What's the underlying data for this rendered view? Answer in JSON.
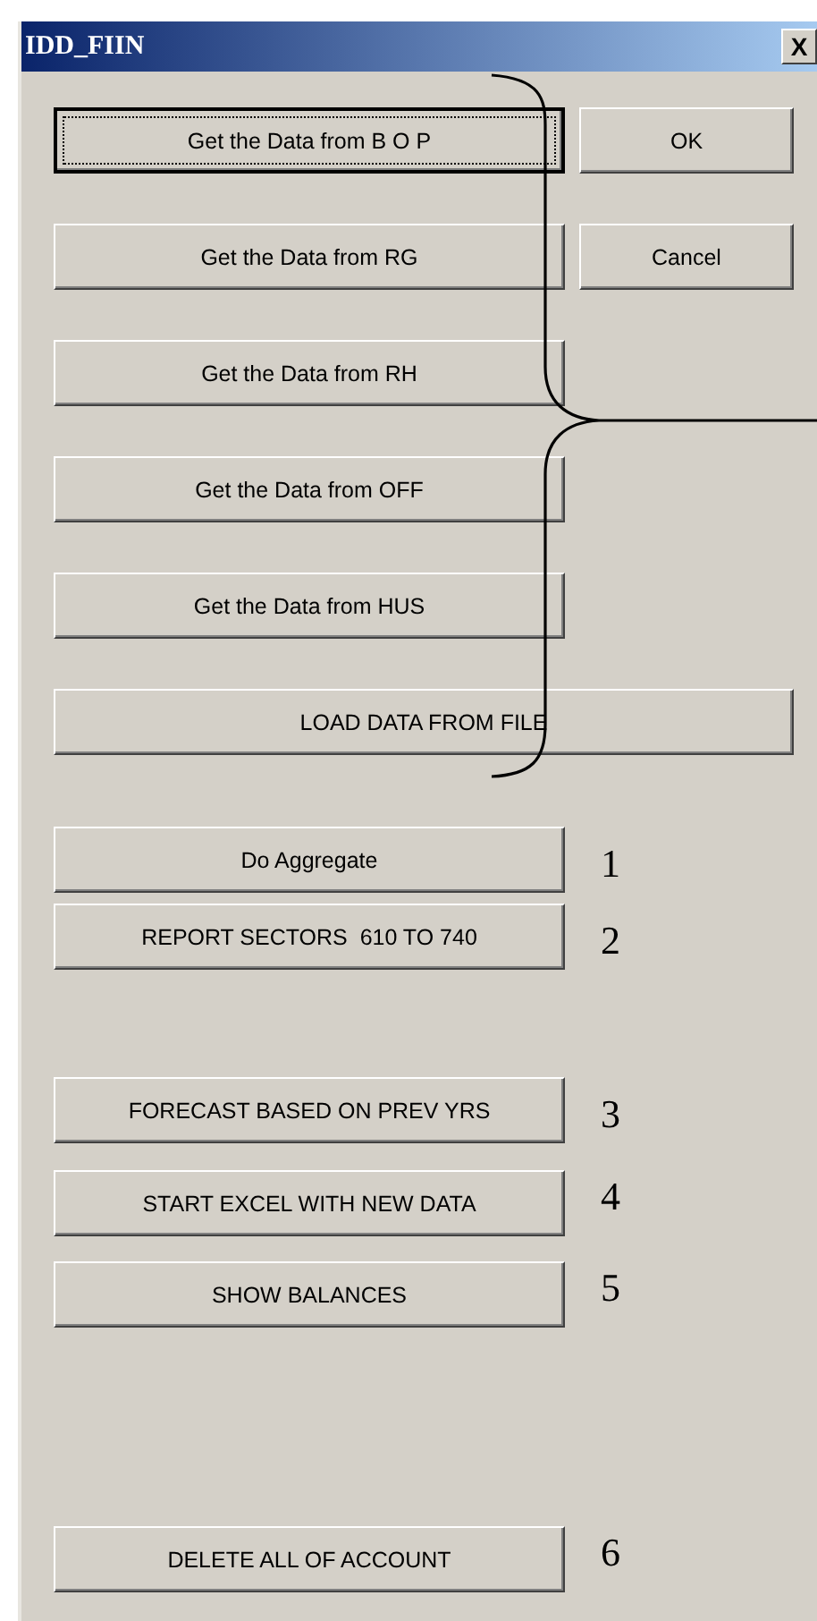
{
  "window": {
    "title": "IDD_FIIN",
    "close_glyph": "X"
  },
  "data_buttons": [
    {
      "label": "Get the Data from B O P",
      "kind": "narrow",
      "focused": true
    },
    {
      "label": "Get the Data from RG",
      "kind": "narrow",
      "focused": false
    },
    {
      "label": "Get the Data from RH",
      "kind": "narrow",
      "focused": false
    },
    {
      "label": "Get the Data from OFF",
      "kind": "narrow",
      "focused": false
    },
    {
      "label": "Get the Data from HUS",
      "kind": "narrow",
      "focused": false
    },
    {
      "label": "LOAD DATA FROM FILE",
      "kind": "wide",
      "focused": false
    }
  ],
  "dialog_buttons": [
    "OK",
    "Cancel"
  ],
  "steps": [
    {
      "label": "Do Aggregate",
      "number": "1"
    },
    {
      "label": "REPORT SECTORS  610 TO 740",
      "number": "2"
    },
    {
      "label": "FORECAST BASED ON PREV YRS",
      "number": "3"
    },
    {
      "label": "START EXCEL WITH NEW DATA",
      "number": "4"
    },
    {
      "label": "SHOW BALANCES",
      "number": "5"
    },
    {
      "label": "DELETE ALL OF ACCOUNT",
      "number": "6"
    }
  ]
}
